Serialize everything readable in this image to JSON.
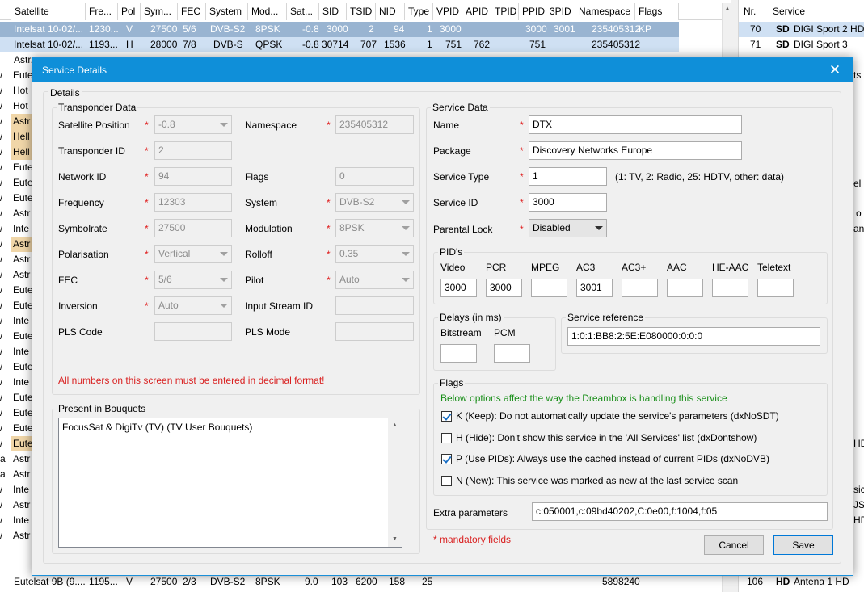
{
  "background_table": {
    "headers": [
      "Satellite",
      "Fre...",
      "Pol",
      "Sym...",
      "FEC",
      "System",
      "Mod...",
      "Sat...",
      "SID",
      "TSID",
      "NID",
      "Type",
      "VPID",
      "APID",
      "TPID",
      "PPID",
      "3PID",
      "Namespace",
      "Flags"
    ],
    "row1": [
      "Intelsat 10-02/...",
      "1230...",
      "V",
      "27500",
      "5/6",
      "DVB-S2",
      "8PSK",
      "-0.8",
      "3000",
      "2",
      "94",
      "1",
      "3000",
      "",
      "",
      "3000",
      "3001",
      "235405312",
      "KP"
    ],
    "row2": [
      "Intelsat 10-02/...",
      "1193...",
      "H",
      "28000",
      "7/8",
      "DVB-S",
      "QPSK",
      "-0.8",
      "30714",
      "707",
      "1536",
      "1",
      "751",
      "762",
      "",
      "751",
      "",
      "235405312",
      ""
    ],
    "row3": [
      "Astr...",
      "",
      "",
      "",
      "",
      "",
      "",
      "",
      "",
      "",
      "",
      "",
      "",
      "",
      "",
      "",
      "",
      "",
      ""
    ],
    "row_last": [
      "Eutelsat 9B (9....",
      "1195...",
      "V",
      "27500",
      "2/3",
      "DVB-S2",
      "8PSK",
      "9.0",
      "103",
      "6200",
      "158",
      "25",
      "",
      "",
      "",
      "",
      "",
      "5898240",
      ""
    ],
    "side_labels": [
      "Eute",
      "Hot",
      "Hot",
      "Astr",
      "Hell",
      "Hell",
      "Eute",
      "Eute",
      "Eute",
      "Astr",
      "Inte",
      "Astr",
      "Astr",
      "Astr",
      "Eute",
      "Eute",
      "Inte",
      "Eute",
      "Inte",
      "Eute",
      "Inte",
      "Eute",
      "Eute",
      "Eute",
      "Eute",
      "Astr",
      "Astr",
      "Inte",
      "Astr",
      "Inte",
      "Astr"
    ],
    "prefix_chars": [
      "/",
      "/",
      "/",
      "/",
      "/",
      "/",
      "/",
      "/",
      "/",
      "/",
      "/",
      "/",
      "/",
      "/",
      "/",
      "/",
      "/",
      "/",
      "/",
      "/",
      "/",
      "/",
      "/",
      "/",
      "/",
      "a",
      "a",
      "/",
      "/",
      "/",
      "/"
    ]
  },
  "right_panel": {
    "headers": [
      "Nr.",
      "Service"
    ],
    "rows": [
      {
        "nr": "70",
        "q": "SD",
        "name": "DIGI Sport 2 HD"
      },
      {
        "nr": "71",
        "q": "SD",
        "name": "DIGI Sport 3"
      }
    ],
    "last_row": {
      "nr": "106",
      "q": "HD",
      "name": "Antena 1 HD"
    },
    "fragments": [
      "ts",
      "el",
      "o",
      "an",
      "HD",
      "sic",
      "JSI",
      "HD"
    ]
  },
  "dialog": {
    "title": "Service Details",
    "close_glyph": "✕",
    "details_label": "Details",
    "transponder": {
      "title": "Transponder Data",
      "satellite_position": {
        "label": "Satellite Position",
        "value": "-0.8"
      },
      "namespace": {
        "label": "Namespace",
        "value": "235405312"
      },
      "transponder_id": {
        "label": "Transponder ID",
        "value": "2"
      },
      "network_id": {
        "label": "Network ID",
        "value": "94"
      },
      "flags": {
        "label": "Flags",
        "value": "0"
      },
      "frequency": {
        "label": "Frequency",
        "value": "12303"
      },
      "system": {
        "label": "System",
        "value": "DVB-S2"
      },
      "symbolrate": {
        "label": "Symbolrate",
        "value": "27500"
      },
      "modulation": {
        "label": "Modulation",
        "value": "8PSK"
      },
      "polarisation": {
        "label": "Polarisation",
        "value": "Vertical"
      },
      "rolloff": {
        "label": "Rolloff",
        "value": "0.35"
      },
      "fec": {
        "label": "FEC",
        "value": "5/6"
      },
      "pilot": {
        "label": "Pilot",
        "value": "Auto"
      },
      "inversion": {
        "label": "Inversion",
        "value": "Auto"
      },
      "input_stream_id": {
        "label": "Input Stream ID",
        "value": ""
      },
      "pls_code": {
        "label": "PLS Code",
        "value": ""
      },
      "pls_mode": {
        "label": "PLS Mode",
        "value": ""
      },
      "warning": "All numbers on this screen must be entered in decimal format!"
    },
    "bouquets": {
      "title": "Present in Bouquets",
      "items": [
        "FocusSat & DigiTv (TV) (TV User Bouquets)"
      ]
    },
    "service": {
      "title": "Service Data",
      "name": {
        "label": "Name",
        "value": "DTX"
      },
      "package": {
        "label": "Package",
        "value": "Discovery Networks Europe"
      },
      "service_type": {
        "label": "Service Type",
        "value": "1",
        "hint": "(1: TV, 2: Radio, 25: HDTV, other: data)"
      },
      "service_id": {
        "label": "Service ID",
        "value": "3000"
      },
      "parental_lock": {
        "label": "Parental Lock",
        "value": "Disabled"
      }
    },
    "pids": {
      "title": "PID's",
      "fields": [
        {
          "label": "Video",
          "value": "3000"
        },
        {
          "label": "PCR",
          "value": "3000"
        },
        {
          "label": "MPEG",
          "value": ""
        },
        {
          "label": "AC3",
          "value": "3001"
        },
        {
          "label": "AC3+",
          "value": ""
        },
        {
          "label": "AAC",
          "value": ""
        },
        {
          "label": "HE-AAC",
          "value": ""
        },
        {
          "label": "Teletext",
          "value": ""
        }
      ]
    },
    "delays": {
      "title": "Delays (in ms)",
      "bitstream": {
        "label": "Bitstream",
        "value": ""
      },
      "pcm": {
        "label": "PCM",
        "value": ""
      }
    },
    "service_reference": {
      "title": "Service reference",
      "value": "1:0:1:BB8:2:5E:E080000:0:0:0"
    },
    "flags": {
      "title": "Flags",
      "note": "Below options affect the way the Dreambox is handling this service",
      "keep": {
        "label": "K (Keep): Do not automatically update the service's parameters (dxNoSDT)",
        "checked": true
      },
      "hide": {
        "label": "H (Hide): Don't show this service in the 'All Services' list (dxDontshow)",
        "checked": false
      },
      "use_pids": {
        "label": "P (Use PIDs): Always use the cached instead of current PIDs (dxNoDVB)",
        "checked": true
      },
      "new": {
        "label": "N (New): This service was marked as new at the last service scan",
        "checked": false
      }
    },
    "extra_parameters": {
      "label": "Extra parameters",
      "value": "c:050001,c:09bd40202,C:0e00,f:1004,f:05"
    },
    "mandatory_note": "* mandatory fields",
    "required_marker": "*",
    "buttons": {
      "cancel": "Cancel",
      "save": "Save"
    },
    "colors": {
      "titlebar": "#0f8fd9",
      "required": "#e02020",
      "note_green": "#1a8f1a"
    }
  }
}
